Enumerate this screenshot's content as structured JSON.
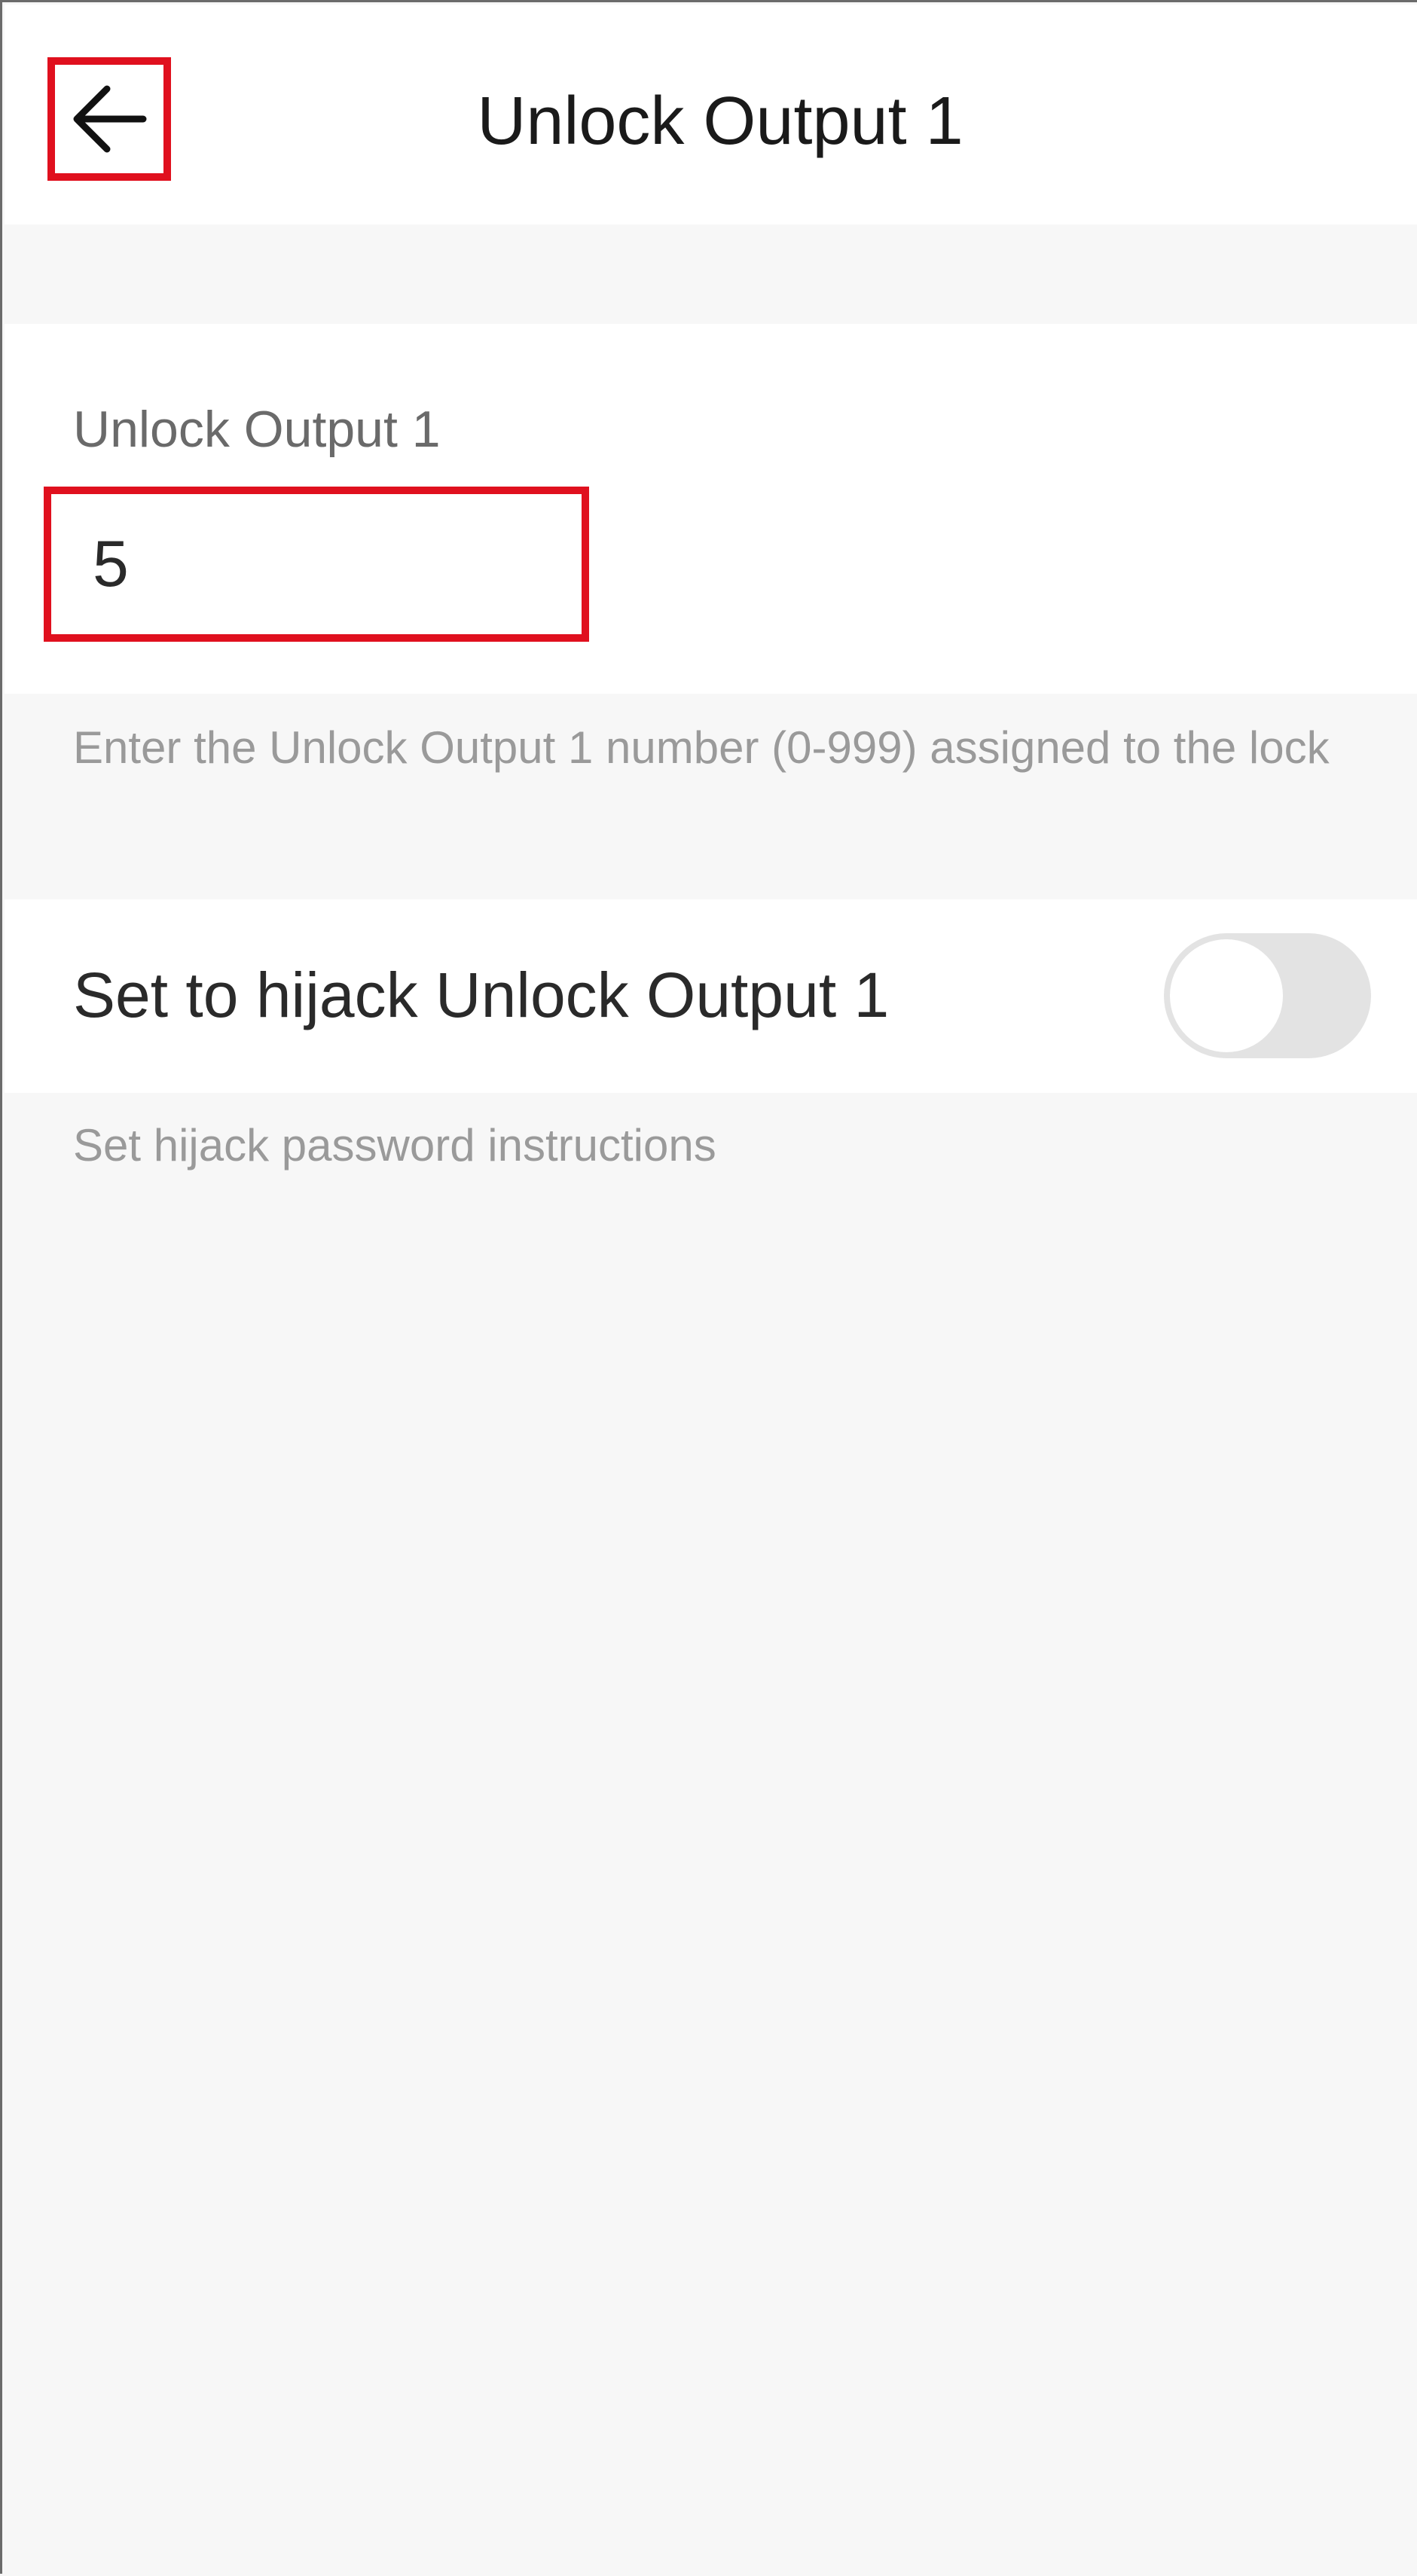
{
  "header": {
    "title": "Unlock Output 1",
    "back_icon": "arrow-left-icon"
  },
  "field": {
    "label": "Unlock Output 1",
    "value": "5",
    "hint": "Enter the Unlock Output 1 number (0-999) assigned to the lock"
  },
  "hijack": {
    "label": "Set to hijack Unlock Output 1",
    "enabled": false,
    "instructions": "Set hijack password instructions"
  },
  "colors": {
    "highlight": "#e0101e",
    "background": "#f7f7f7",
    "toggle_off": "#e3e3e3"
  }
}
